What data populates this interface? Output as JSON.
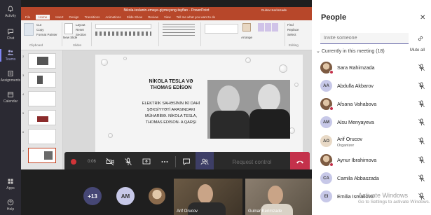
{
  "rail": {
    "items": [
      {
        "label": "Activity"
      },
      {
        "label": "Chat"
      },
      {
        "label": "Teams"
      },
      {
        "label": "Assignments"
      },
      {
        "label": "Calendar"
      },
      {
        "label": "Apps"
      },
      {
        "label": "Help"
      }
    ]
  },
  "ppt": {
    "window_title": "Nikola-teslanin-emaye-giymeyeng-tayfları - PowerPoint",
    "user_name": "Gulnar Kerimzade",
    "tabs": [
      "File",
      "Home",
      "Insert",
      "Design",
      "Transitions",
      "Animations",
      "Slide Show",
      "Review",
      "View",
      "Tell me what you want to do"
    ],
    "ribbon": {
      "cut": "Cut",
      "copy": "Copy",
      "format_painter": "Format Painter",
      "clipboard": "Clipboard",
      "new_slide": "New Slide",
      "layout": "Layout",
      "reset": "Reset",
      "section": "Section",
      "slides": "Slides",
      "arrange": "Arrange",
      "find": "Find",
      "replace": "Replace",
      "select": "Select",
      "editing": "Editing"
    },
    "thumb_numbers": [
      "2",
      "3",
      "4",
      "5",
      "6",
      "7"
    ],
    "slide": {
      "title": "NİKOLA TESLA VƏ THOMAS EDİSON",
      "body": "ELEKTRİK SAHƏSİNİN İKİ DAHİ ŞƏXSİYYƏTİ ARASINDAKI MÜHARİBƏ. NİKOLA TESLA, THOMAS EDİSON- A QARŞI"
    }
  },
  "controls": {
    "time": "0:06",
    "request_control": "Request control"
  },
  "strip": {
    "overflow_count": "+13",
    "am_initials": "AM",
    "video1_name": "Arif Orucov",
    "video2_name": "Gulnar Kerimzade"
  },
  "people": {
    "title": "People",
    "invite_placeholder": "Invite someone",
    "section_label": "Currently in this meeting (18)",
    "mute_all": "Mute all",
    "participants": [
      {
        "initials": "",
        "name": "Sara Rahimzada",
        "role": ""
      },
      {
        "initials": "AA",
        "name": "Abdulla Akbarov",
        "role": ""
      },
      {
        "initials": "",
        "name": "Afsana Vahabova",
        "role": ""
      },
      {
        "initials": "AM",
        "name": "Alsu Menyayeva",
        "role": ""
      },
      {
        "initials": "AO",
        "name": "Arif Orucov",
        "role": "Organizer"
      },
      {
        "initials": "",
        "name": "Aynur Ibrahimova",
        "role": ""
      },
      {
        "initials": "CA",
        "name": "Camila Abbaszada",
        "role": ""
      },
      {
        "initials": "EI",
        "name": "Emilia Ismailova",
        "role": ""
      }
    ]
  },
  "watermark": {
    "line1": "Activate Windows",
    "line2": "Go to Settings to activate Windows."
  },
  "colors": {
    "teams_accent": "#6264a7",
    "ppt_brand": "#b7472a",
    "hangup": "#c4314b",
    "rail_bg": "#2b2a33"
  }
}
